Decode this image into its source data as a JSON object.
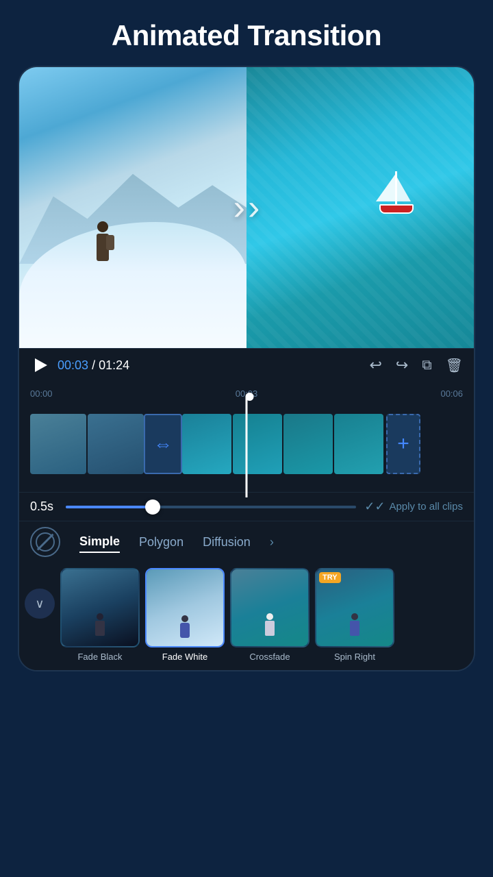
{
  "page": {
    "title": "Animated Transition",
    "bg_color": "#0d2340"
  },
  "video": {
    "current_time": "00:03",
    "total_time": "01:24",
    "transition_arrows": "»"
  },
  "controls": {
    "play_label": "▶",
    "undo_label": "↩",
    "redo_label": "↪",
    "copy_label": "⧉",
    "delete_label": "🗑"
  },
  "timeline": {
    "marks": [
      "00:00",
      "00:03",
      "00:06"
    ]
  },
  "duration": {
    "value": "0.5s",
    "apply_label": "Apply to all clips"
  },
  "categories": {
    "tabs": [
      {
        "id": "simple",
        "label": "Simple",
        "active": true
      },
      {
        "id": "polygon",
        "label": "Polygon",
        "active": false
      },
      {
        "id": "diffusion",
        "label": "Diffusion",
        "active": false
      }
    ]
  },
  "transitions": [
    {
      "id": "fade-black",
      "label": "Fade Black",
      "selected": false,
      "try": false
    },
    {
      "id": "fade-white",
      "label": "Fade White",
      "selected": true,
      "try": false
    },
    {
      "id": "crossfade",
      "label": "Crossfade",
      "selected": false,
      "try": false
    },
    {
      "id": "spin-right",
      "label": "Spin Right",
      "selected": false,
      "try": true
    }
  ]
}
